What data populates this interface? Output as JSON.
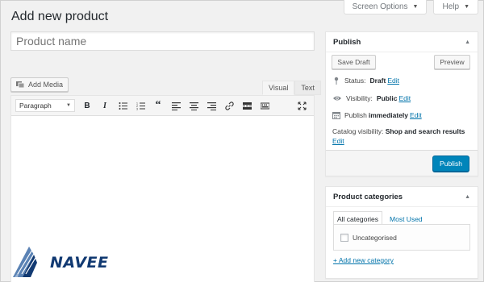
{
  "screen_meta": {
    "screen_options": "Screen Options",
    "help": "Help"
  },
  "page_title": "Add new product",
  "title_input": {
    "placeholder": "Product name",
    "value": ""
  },
  "editor": {
    "add_media": "Add Media",
    "tabs": [
      "Visual",
      "Text"
    ],
    "format_select": "Paragraph",
    "toolbar_icons": [
      "bold-icon",
      "italic-icon",
      "bullet-list-icon",
      "numbered-list-icon",
      "blockquote-icon",
      "align-left-icon",
      "align-center-icon",
      "align-right-icon",
      "link-icon",
      "read-more-icon",
      "toolbar-toggle-icon",
      "fullscreen-icon"
    ]
  },
  "publish": {
    "title": "Publish",
    "save_draft": "Save Draft",
    "preview": "Preview",
    "status_label": "Status:",
    "status_value": "Draft",
    "visibility_label": "Visibility:",
    "visibility_value": "Public",
    "publish_label": "Publish",
    "publish_value": "immediately",
    "catalog_label": "Catalog visibility:",
    "catalog_value": "Shop and search results",
    "edit": "Edit",
    "publish_button": "Publish",
    "primary_color": "#0085ba"
  },
  "categories": {
    "title": "Product categories",
    "tabs": [
      "All categories",
      "Most Used"
    ],
    "items": [
      "Uncategorised"
    ],
    "add_new": "+ Add new category"
  },
  "logo": {
    "text": "NAVEE"
  }
}
